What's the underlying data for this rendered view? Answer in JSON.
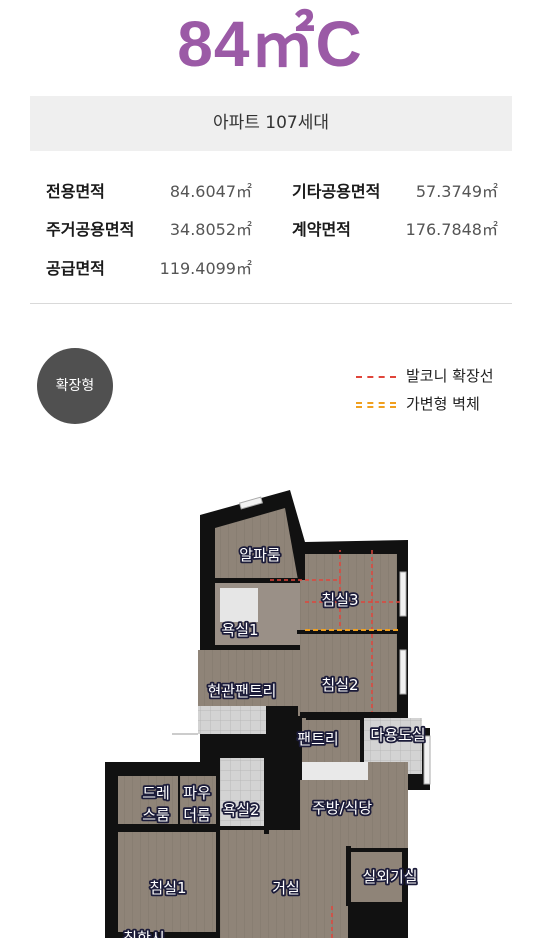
{
  "header": {
    "title": "84㎡C",
    "type_bar": "아파트 107세대"
  },
  "specs": [
    {
      "label": "전용면적",
      "value": "84.6047㎡"
    },
    {
      "label": "기타공용면적",
      "value": "57.3749㎡"
    },
    {
      "label": "주거공용면적",
      "value": "34.8052㎡"
    },
    {
      "label": "계약면적",
      "value": "176.7848㎡"
    },
    {
      "label": "공급면적",
      "value": "119.4099㎡"
    }
  ],
  "badge": "확장형",
  "legend": [
    {
      "label": "발코니 확장선",
      "color": "#e0453a",
      "style": "dashed"
    },
    {
      "label": "가변형 벽체",
      "color": "#f0a020",
      "style": "double-dashed"
    }
  ],
  "rooms": {
    "alpha": "알파룸",
    "bedroom3": "침실3",
    "bath1": "욕실1",
    "bedroom2": "침실2",
    "entry_pantry": "현관팬트리",
    "pantry": "팬트리",
    "utility": "다용도실",
    "dress1": "드레",
    "dress2": "스룸",
    "powder1": "파우",
    "powder2": "더룸",
    "bath2": "욕실2",
    "kitchen": "주방/식당",
    "bedroom1": "침실1",
    "living": "거실",
    "outdoor": "실외기실",
    "bottom_cut": "침한시"
  }
}
